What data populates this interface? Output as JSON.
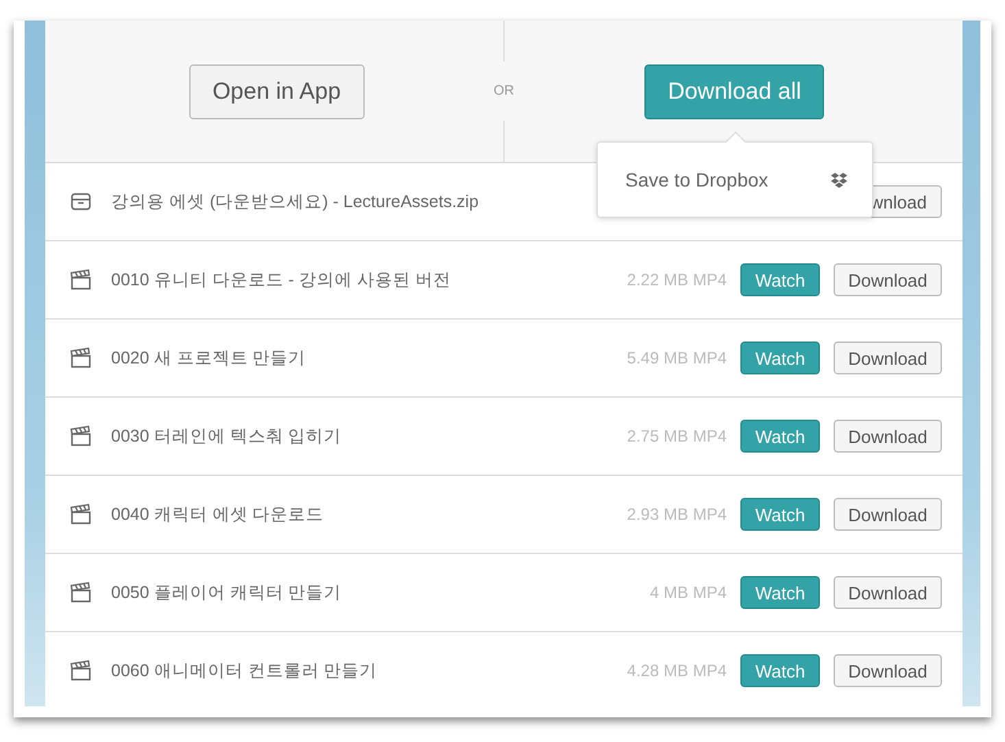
{
  "header": {
    "open_button": "Open in App",
    "separator": "OR",
    "download_all_button": "Download all"
  },
  "dropdown": {
    "items": [
      {
        "label": "Save to Dropbox"
      }
    ]
  },
  "files": [
    {
      "kind": "archive",
      "name": "강의용 에셋 (다운받으세요) - LectureAssets.zip",
      "download": "wnload"
    },
    {
      "kind": "video",
      "name": "0010 유니티 다운로드 - 강의에 사용된 버전",
      "size": "2.22 MB MP4",
      "watch": "Watch",
      "download": "Download"
    },
    {
      "kind": "video",
      "name": "0020 새 프로젝트 만들기",
      "size": "5.49 MB MP4",
      "watch": "Watch",
      "download": "Download"
    },
    {
      "kind": "video",
      "name": "0030 터레인에 텍스춰 입히기",
      "size": "2.75 MB MP4",
      "watch": "Watch",
      "download": "Download"
    },
    {
      "kind": "video",
      "name": "0040 캐릭터 에셋 다운로드",
      "size": "2.93 MB MP4",
      "watch": "Watch",
      "download": "Download"
    },
    {
      "kind": "video",
      "name": "0050 플레이어 캐릭터 만들기",
      "size": "4 MB MP4",
      "watch": "Watch",
      "download": "Download"
    },
    {
      "kind": "video",
      "name": "0060 애니메이터 컨트롤러 만들기",
      "size": "4.28 MB MP4",
      "watch": "Watch",
      "download": "Download"
    }
  ]
}
